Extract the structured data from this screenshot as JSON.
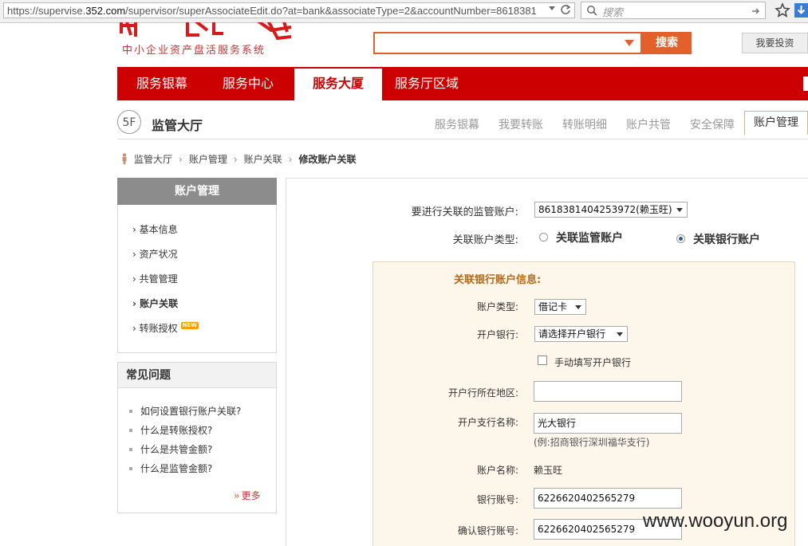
{
  "browser": {
    "url_prefix": "https://supervise.",
    "url_domain": "352.com",
    "url_rest": "/supervisor/superAssociateEdit.do?at=bank&associateType=2&accountNumber=8618381",
    "search_placeholder": "搜索"
  },
  "header": {
    "logo_subtitle": "中小企业资产盘活服务系统",
    "site_search_value": "",
    "site_search_button": "搜索",
    "invest_button": "我要投资"
  },
  "mainnav": {
    "items": [
      {
        "label": "服务银幕"
      },
      {
        "label": "服务中心"
      },
      {
        "label": "服务大厦"
      },
      {
        "label": "服务厅区域"
      }
    ]
  },
  "floor": {
    "badge": "5F",
    "title": "监管大厅",
    "subnav": [
      "服务银幕",
      "我要转账",
      "转账明细",
      "账户共管",
      "安全保障"
    ],
    "active": "账户管理"
  },
  "breadcrumb": [
    "监管大厅",
    "账户管理",
    "账户关联",
    "修改账户关联"
  ],
  "sidebar": {
    "title": "账户管理",
    "items": [
      {
        "label": "基本信息"
      },
      {
        "label": "资产状况"
      },
      {
        "label": "共管管理"
      },
      {
        "label": "账户关联"
      },
      {
        "label": "转账授权"
      }
    ],
    "new_badge": "NEW",
    "faq_title": "常见问题",
    "faq": [
      {
        "label": "如何设置银行账户关联?"
      },
      {
        "label": "什么是转账授权?"
      },
      {
        "label": "什么是共管金额?"
      },
      {
        "label": "什么是监管金额?"
      }
    ],
    "more": "更多"
  },
  "form": {
    "supervise_account_label": "要进行关联的监管账户:",
    "supervise_account_value": "8618381404253972(赖玉旺)",
    "assoc_type_label": "关联账户类型:",
    "radio_supervise": "关联监管账户",
    "radio_bank": "关联银行账户",
    "selected_type": "bank",
    "panel_title": "关联银行账户信息:",
    "account_type_label": "账户类型:",
    "account_type_value": "借记卡",
    "open_bank_label": "开户银行:",
    "open_bank_value": "请选择开户银行",
    "manual_bank_label": "手动填写开户银行",
    "region_label": "开户行所在地区:",
    "region_value": "",
    "branch_label": "开户支行名称:",
    "branch_value": "光大银行",
    "branch_hint": "(例:招商银行深圳福华支行)",
    "account_name_label": "账户名称:",
    "account_name_value": "赖玉旺",
    "bank_account_label": "银行账号:",
    "bank_account_value": "6226620402565279",
    "confirm_account_label": "确认银行账号:",
    "confirm_account_value": "6226620402565279"
  },
  "watermark": "www.wooyun.org",
  "colors": {
    "brand_red": "#cc0000",
    "accent_orange": "#e2602a",
    "panel_bg": "#fdf6ea"
  }
}
